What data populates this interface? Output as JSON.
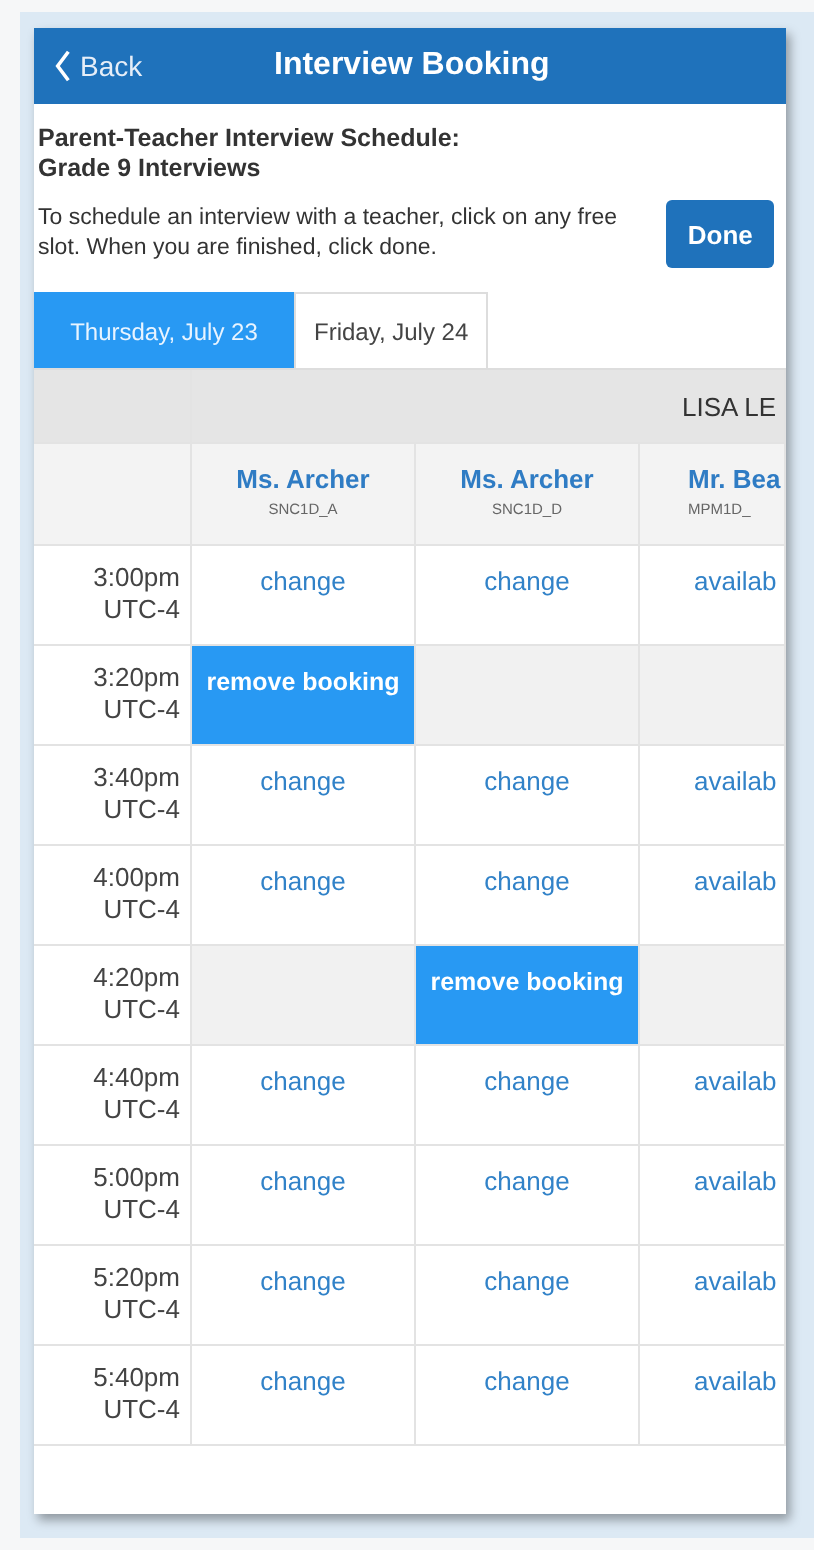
{
  "header": {
    "back": "Back",
    "title": "Interview Booking"
  },
  "heading": [
    "Parent-Teacher Interview Schedule:",
    "Grade 9 Interviews"
  ],
  "instructions": "To schedule an interview with a teacher, click on any free slot. When you are finished, click done.",
  "done_button": "Done",
  "tabs": [
    {
      "label": "Thursday, July 23",
      "selected": true
    },
    {
      "label": "Friday, July 24",
      "selected": false
    }
  ],
  "table": {
    "group": "LISA LE",
    "columns": [
      {
        "teacher": "Ms. Archer",
        "course": "SNC1D_A"
      },
      {
        "teacher": "Ms. Archer",
        "course": "SNC1D_D"
      },
      {
        "teacher": "Mr. Bea",
        "course": "MPM1D_"
      }
    ],
    "rows": [
      {
        "time": "3:00pm",
        "zone": "UTC-4",
        "cells": [
          {
            "kind": "link",
            "text": "change"
          },
          {
            "kind": "link",
            "text": "change"
          },
          {
            "kind": "link",
            "text": "availab"
          }
        ]
      },
      {
        "time": "3:20pm",
        "zone": "UTC-4",
        "cells": [
          {
            "kind": "booked",
            "text": "remove booking"
          },
          {
            "kind": "empty"
          },
          {
            "kind": "empty"
          }
        ]
      },
      {
        "time": "3:40pm",
        "zone": "UTC-4",
        "cells": [
          {
            "kind": "link",
            "text": "change"
          },
          {
            "kind": "link",
            "text": "change"
          },
          {
            "kind": "link",
            "text": "availab"
          }
        ]
      },
      {
        "time": "4:00pm",
        "zone": "UTC-4",
        "cells": [
          {
            "kind": "link",
            "text": "change"
          },
          {
            "kind": "link",
            "text": "change"
          },
          {
            "kind": "link",
            "text": "availab"
          }
        ]
      },
      {
        "time": "4:20pm",
        "zone": "UTC-4",
        "cells": [
          {
            "kind": "empty"
          },
          {
            "kind": "booked",
            "text": "remove booking"
          },
          {
            "kind": "empty"
          }
        ]
      },
      {
        "time": "4:40pm",
        "zone": "UTC-4",
        "cells": [
          {
            "kind": "link",
            "text": "change"
          },
          {
            "kind": "link",
            "text": "change"
          },
          {
            "kind": "link",
            "text": "availab"
          }
        ]
      },
      {
        "time": "5:00pm",
        "zone": "UTC-4",
        "cells": [
          {
            "kind": "link",
            "text": "change"
          },
          {
            "kind": "link",
            "text": "change"
          },
          {
            "kind": "link",
            "text": "availab"
          }
        ]
      },
      {
        "time": "5:20pm",
        "zone": "UTC-4",
        "cells": [
          {
            "kind": "link",
            "text": "change"
          },
          {
            "kind": "link",
            "text": "change"
          },
          {
            "kind": "link",
            "text": "availab"
          }
        ]
      },
      {
        "time": "5:40pm",
        "zone": "UTC-4",
        "cells": [
          {
            "kind": "link",
            "text": "change"
          },
          {
            "kind": "link",
            "text": "change"
          },
          {
            "kind": "link",
            "text": "availab"
          }
        ]
      }
    ]
  }
}
